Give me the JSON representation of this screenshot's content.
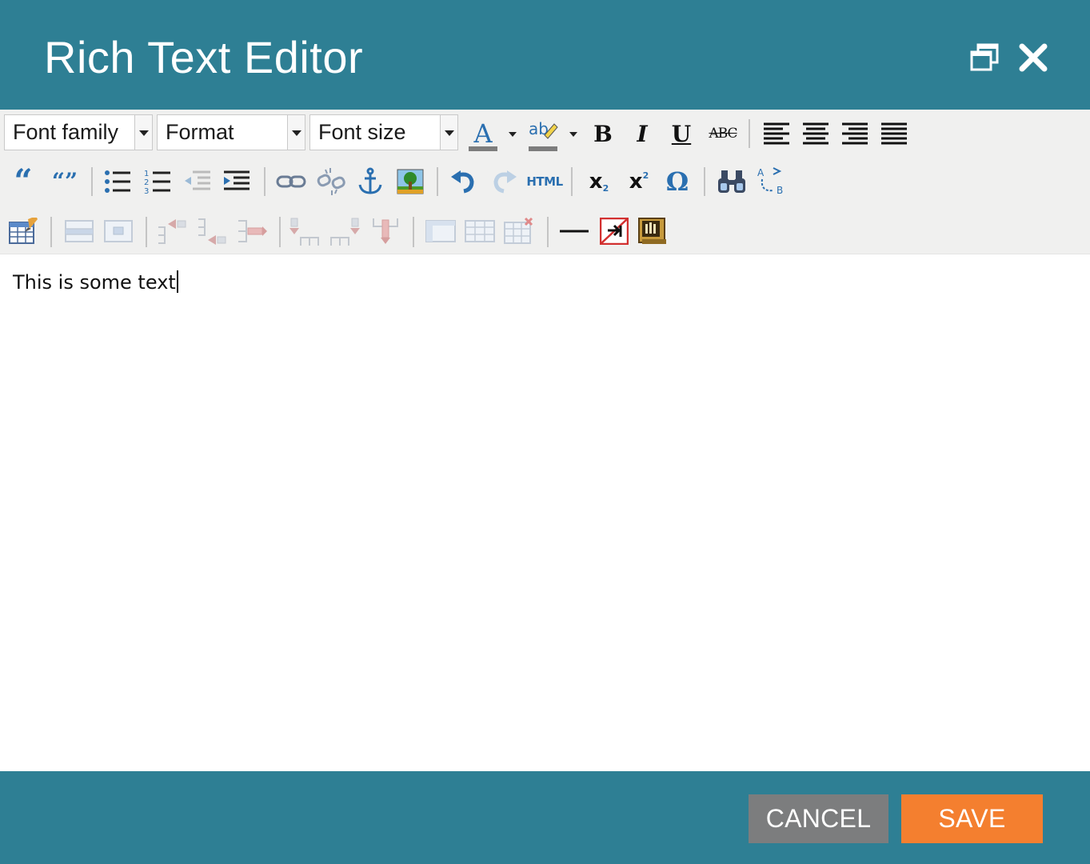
{
  "dialog": {
    "title": "Rich Text Editor",
    "header_icons": [
      "restore-icon",
      "close-icon"
    ]
  },
  "toolbar": {
    "font_family": "Font family",
    "format": "Format",
    "font_size": "Font size",
    "row1_icons": [
      "text-color-icon",
      "highlight-color-icon",
      "bold-icon",
      "italic-icon",
      "underline-icon",
      "strikethrough-icon",
      "align-left-icon",
      "align-center-icon",
      "align-right-icon",
      "align-justify-icon"
    ],
    "row2_icons": [
      "blockquote-icon",
      "cite-icon",
      "bullet-list-icon",
      "numbered-list-icon",
      "outdent-icon",
      "indent-icon",
      "link-icon",
      "unlink-icon",
      "anchor-icon",
      "image-icon",
      "undo-icon",
      "redo-icon",
      "html-source-icon",
      "subscript-icon",
      "superscript-icon",
      "special-character-icon",
      "find-icon",
      "replace-icon"
    ],
    "row3_icons": [
      "insert-table-icon",
      "row-properties-icon",
      "cell-properties-icon",
      "insert-row-before-icon",
      "insert-row-after-icon",
      "delete-row-icon",
      "insert-column-before-icon",
      "insert-column-after-icon",
      "delete-column-icon",
      "split-cells-icon",
      "merge-cells-icon",
      "delete-table-icon",
      "horizontal-rule-icon",
      "remove-format-icon",
      "template-icon"
    ],
    "labels": {
      "bold": "B",
      "italic": "I",
      "underline": "U",
      "strike": "ABC",
      "html": "HTML",
      "sub": "x",
      "sub_mark": "2",
      "sup": "x",
      "sup_mark": "2",
      "omega": "Ω",
      "text_color": "A",
      "highlight": "ab"
    }
  },
  "editor": {
    "content": "This is some text"
  },
  "footer": {
    "cancel_label": "CANCEL",
    "save_label": "SAVE"
  },
  "colors": {
    "header_bg": "#2e7f94",
    "toolbar_bg": "#f0f0ef",
    "cancel_bg": "#7c7d7e",
    "save_bg": "#f47f2f",
    "icon_blue": "#2a6fb0"
  }
}
